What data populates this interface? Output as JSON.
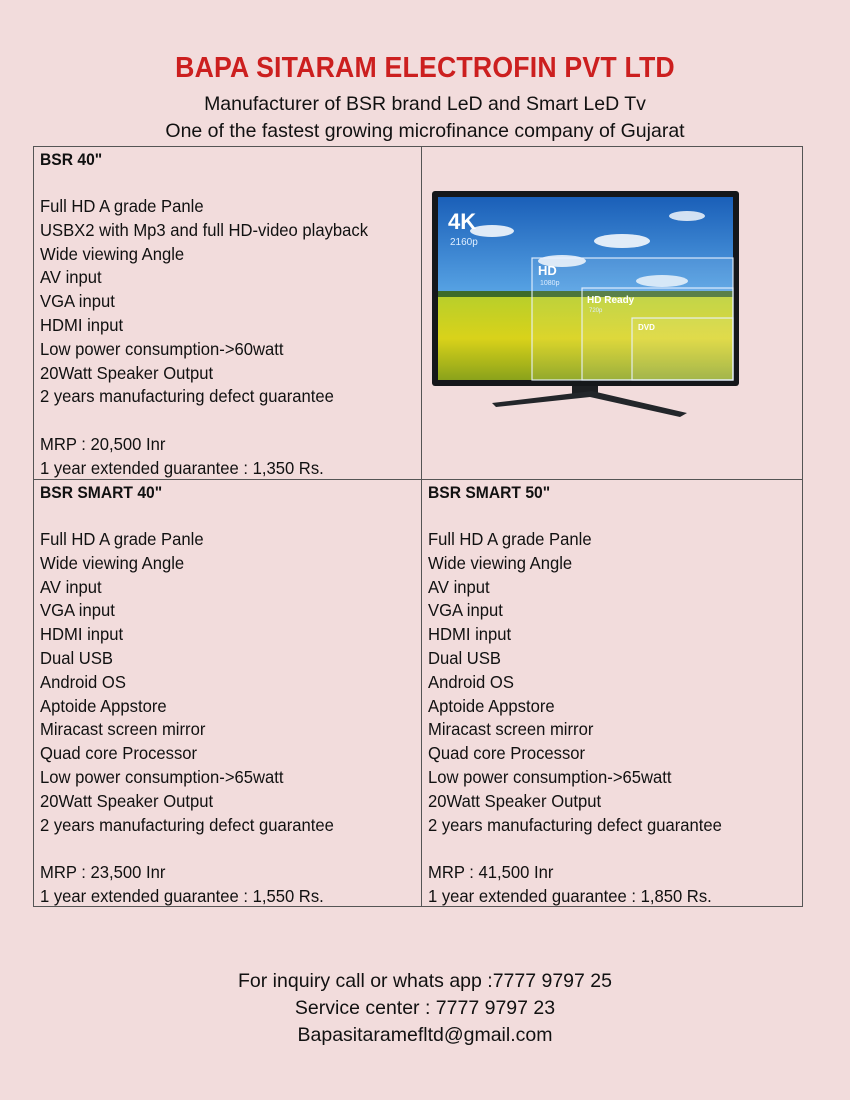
{
  "header": {
    "company": "BAPA SITARAM ELECTROFIN PVT LTD",
    "tagline1": "Manufacturer of BSR brand LeD and Smart LeD Tv",
    "tagline2": "One of the fastest growing microfinance company of Gujarat"
  },
  "products": {
    "bsr40": {
      "model": "BSR  40\"",
      "features": [
        "Full HD A grade Panle",
        "USBX2 with Mp3 and full HD-video playback",
        "Wide viewing Angle",
        "AV input",
        "VGA input",
        "HDMI input",
        "Low power consumption->60watt",
        "20Watt Speaker Output",
        "2 years manufacturing defect guarantee"
      ],
      "mrp": "MRP : 20,500 Inr",
      "guarantee": "1 year extended guarantee : 1,350 Rs."
    },
    "smart40": {
      "model": "BSR  SMART 40\"",
      "features": [
        "Full HD A grade Panle",
        "Wide viewing Angle",
        "AV input",
        "VGA input",
        "HDMI input",
        "Dual USB",
        "Android OS",
        "Aptoide Appstore",
        "Miracast screen mirror",
        "Quad core Processor",
        "Low power consumption->65watt",
        "20Watt Speaker Output",
        "2 years manufacturing defect guarantee"
      ],
      "mrp": "MRP : 23,500 Inr",
      "guarantee": "1 year extended guarantee : 1,550 Rs."
    },
    "smart50": {
      "model": "BSR  SMART 50\"",
      "features": [
        "Full HD A grade Panle",
        "Wide viewing Angle",
        "AV input",
        "VGA input",
        "HDMI input",
        "Dual USB",
        "Android OS",
        "Aptoide Appstore",
        "Miracast screen mirror",
        "Quad core Processor",
        "Low power consumption->65watt",
        "20Watt Speaker Output",
        "2 years manufacturing defect guarantee"
      ],
      "mrp": "MRP : 41,500 Inr",
      "guarantee": "1 year extended guarantee : 1,850 Rs."
    }
  },
  "tv_image": {
    "label_4k": "4K",
    "label_4k_sub": "2160p",
    "label_hd": "HD",
    "label_hd_sub": "1080p",
    "label_hdready": "HD Ready",
    "label_hdready_sub": "720p",
    "label_dvd": "DVD"
  },
  "footer": {
    "inquiry": "For inquiry call or whats app :7777 9797 25",
    "service": "Service center : 7777 9797 23",
    "email": "Bapasitaramefltd@gmail.com"
  },
  "colors": {
    "background": "#f2dcdc",
    "title": "#cc1f1f",
    "border": "#555555"
  }
}
